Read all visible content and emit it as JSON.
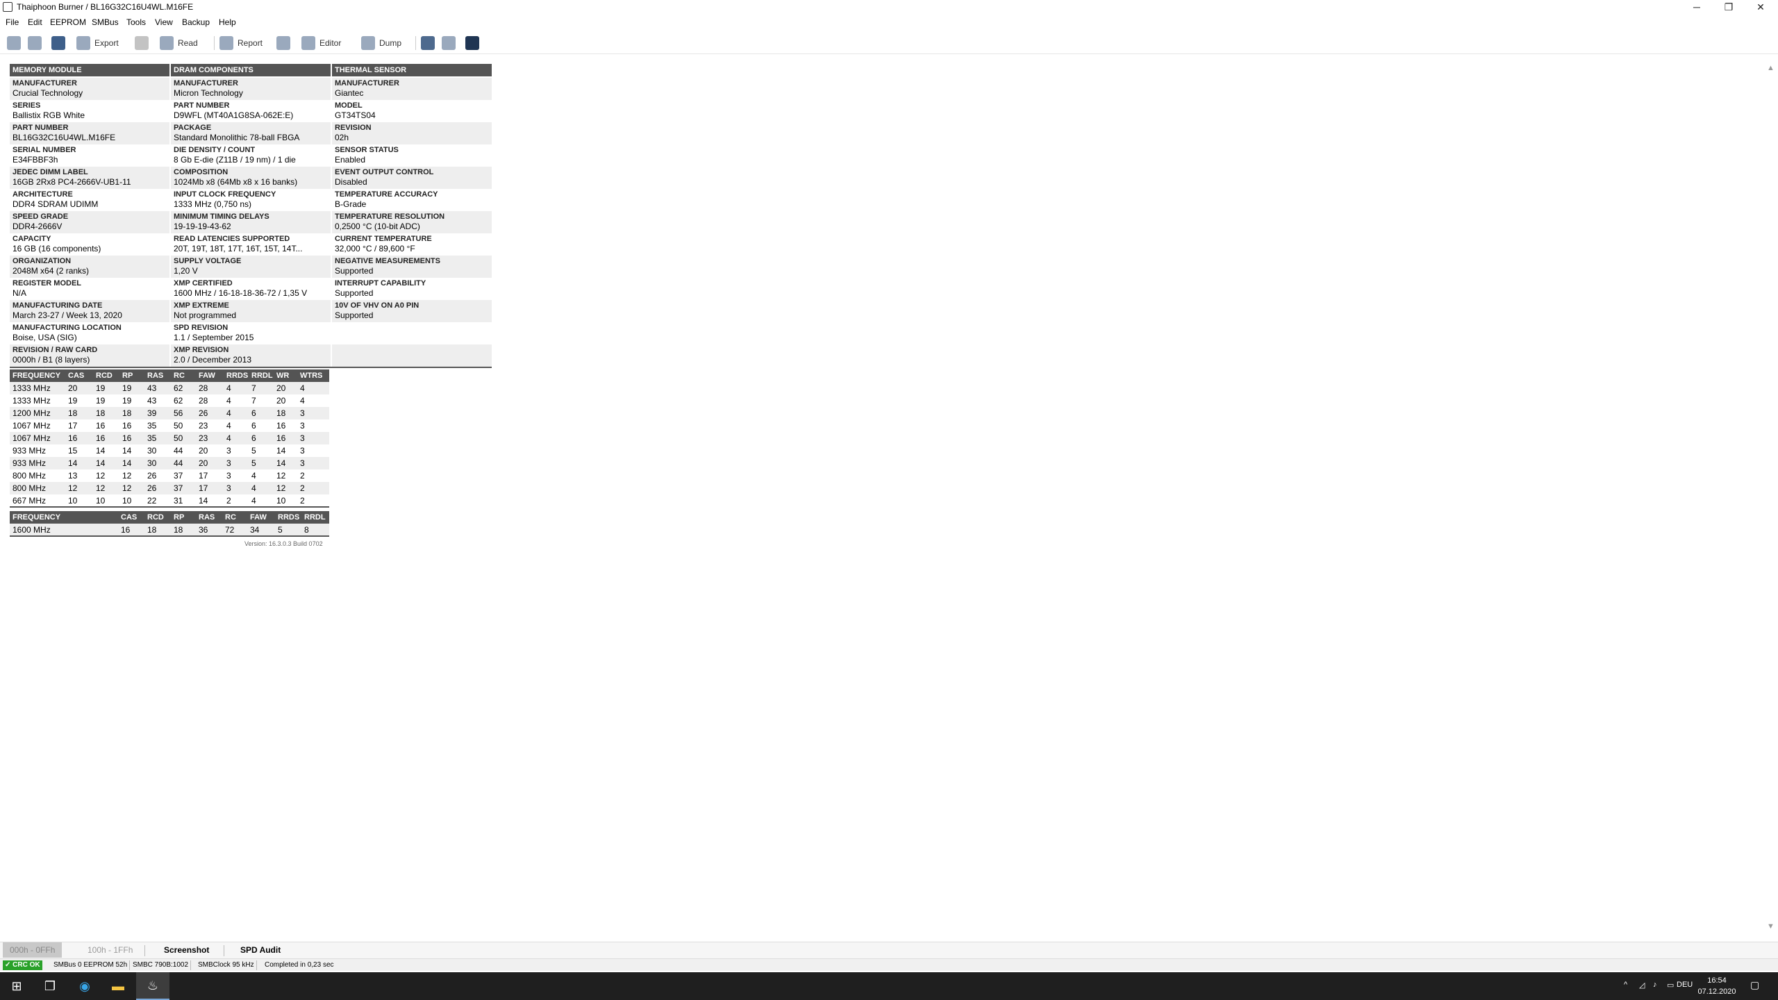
{
  "window": {
    "title": "Thaiphoon Burner / BL16G32C16U4WL.M16FE",
    "min_glyph": "─",
    "max_glyph": "❐",
    "close_glyph": "✕"
  },
  "menu": [
    "File",
    "Edit",
    "EEPROM",
    "SMBus",
    "Tools",
    "View",
    "Backup",
    "Help"
  ],
  "toolbar": {
    "export": "Export",
    "read": "Read",
    "report": "Report",
    "editor": "Editor",
    "dump": "Dump"
  },
  "memory_module": {
    "header": "MEMORY MODULE",
    "rows": [
      {
        "k": "MANUFACTURER",
        "v": "Crucial Technology"
      },
      {
        "k": "SERIES",
        "v": "Ballistix RGB White"
      },
      {
        "k": "PART NUMBER",
        "v": "BL16G32C16U4WL.M16FE"
      },
      {
        "k": "SERIAL NUMBER",
        "v": "E34FBBF3h"
      },
      {
        "k": "JEDEC DIMM LABEL",
        "v": "16GB 2Rx8 PC4-2666V-UB1-11"
      },
      {
        "k": "ARCHITECTURE",
        "v": "DDR4 SDRAM UDIMM"
      },
      {
        "k": "SPEED GRADE",
        "v": "DDR4-2666V"
      },
      {
        "k": "CAPACITY",
        "v": "16 GB (16 components)"
      },
      {
        "k": "ORGANIZATION",
        "v": "2048M x64 (2 ranks)"
      },
      {
        "k": "REGISTER MODEL",
        "v": "N/A"
      },
      {
        "k": "MANUFACTURING DATE",
        "v": "March 23-27 / Week 13, 2020"
      },
      {
        "k": "MANUFACTURING LOCATION",
        "v": "Boise, USA (SIG)"
      },
      {
        "k": "REVISION / RAW CARD",
        "v": "0000h / B1 (8 layers)"
      }
    ]
  },
  "dram_components": {
    "header": "DRAM COMPONENTS",
    "rows": [
      {
        "k": "MANUFACTURER",
        "v": "Micron Technology"
      },
      {
        "k": "PART NUMBER",
        "v": "D9WFL (MT40A1G8SA-062E:E)"
      },
      {
        "k": "PACKAGE",
        "v": "Standard Monolithic 78-ball FBGA"
      },
      {
        "k": "DIE DENSITY / COUNT",
        "v": "8 Gb E-die (Z11B / 19 nm) / 1 die"
      },
      {
        "k": "COMPOSITION",
        "v": "1024Mb x8 (64Mb x8 x 16 banks)"
      },
      {
        "k": "INPUT CLOCK FREQUENCY",
        "v": "1333 MHz (0,750 ns)"
      },
      {
        "k": "MINIMUM TIMING DELAYS",
        "v": "19-19-19-43-62"
      },
      {
        "k": "READ LATENCIES SUPPORTED",
        "v": "20T, 19T, 18T, 17T, 16T, 15T, 14T..."
      },
      {
        "k": "SUPPLY VOLTAGE",
        "v": "1,20 V"
      },
      {
        "k": "XMP CERTIFIED",
        "v": "1600 MHz / 16-18-18-36-72 / 1,35 V"
      },
      {
        "k": "XMP EXTREME",
        "v": "Not programmed"
      },
      {
        "k": "SPD REVISION",
        "v": "1.1 / September 2015"
      },
      {
        "k": "XMP REVISION",
        "v": "2.0 / December 2013"
      }
    ]
  },
  "thermal_sensor": {
    "header": "THERMAL SENSOR",
    "rows": [
      {
        "k": "MANUFACTURER",
        "v": "Giantec"
      },
      {
        "k": "MODEL",
        "v": "GT34TS04"
      },
      {
        "k": "REVISION",
        "v": "02h"
      },
      {
        "k": "SENSOR STATUS",
        "v": "Enabled"
      },
      {
        "k": "EVENT OUTPUT CONTROL",
        "v": "Disabled"
      },
      {
        "k": "TEMPERATURE ACCURACY",
        "v": "B-Grade"
      },
      {
        "k": "TEMPERATURE RESOLUTION",
        "v": "0,2500 °C (10-bit ADC)"
      },
      {
        "k": "CURRENT TEMPERATURE",
        "v": "32,000 °C / 89,600 °F"
      },
      {
        "k": "NEGATIVE MEASUREMENTS",
        "v": "Supported"
      },
      {
        "k": "INTERRUPT CAPABILITY",
        "v": "Supported"
      },
      {
        "k": "10V OF VHV ON A0 PIN",
        "v": "Supported"
      },
      {
        "k": "",
        "v": ""
      },
      {
        "k": "",
        "v": ""
      }
    ]
  },
  "jedec_timings": {
    "headers": [
      "FREQUENCY",
      "CAS",
      "RCD",
      "RP",
      "RAS",
      "RC",
      "FAW",
      "RRDS",
      "RRDL",
      "WR",
      "WTRS"
    ],
    "rows": [
      [
        "1333 MHz",
        "20",
        "19",
        "19",
        "43",
        "62",
        "28",
        "4",
        "7",
        "20",
        "4"
      ],
      [
        "1333 MHz",
        "19",
        "19",
        "19",
        "43",
        "62",
        "28",
        "4",
        "7",
        "20",
        "4"
      ],
      [
        "1200 MHz",
        "18",
        "18",
        "18",
        "39",
        "56",
        "26",
        "4",
        "6",
        "18",
        "3"
      ],
      [
        "1067 MHz",
        "17",
        "16",
        "16",
        "35",
        "50",
        "23",
        "4",
        "6",
        "16",
        "3"
      ],
      [
        "1067 MHz",
        "16",
        "16",
        "16",
        "35",
        "50",
        "23",
        "4",
        "6",
        "16",
        "3"
      ],
      [
        "933 MHz",
        "15",
        "14",
        "14",
        "30",
        "44",
        "20",
        "3",
        "5",
        "14",
        "3"
      ],
      [
        "933 MHz",
        "14",
        "14",
        "14",
        "30",
        "44",
        "20",
        "3",
        "5",
        "14",
        "3"
      ],
      [
        "800 MHz",
        "13",
        "12",
        "12",
        "26",
        "37",
        "17",
        "3",
        "4",
        "12",
        "2"
      ],
      [
        "800 MHz",
        "12",
        "12",
        "12",
        "26",
        "37",
        "17",
        "3",
        "4",
        "12",
        "2"
      ],
      [
        "667 MHz",
        "10",
        "10",
        "10",
        "22",
        "31",
        "14",
        "2",
        "4",
        "10",
        "2"
      ]
    ]
  },
  "xmp_timings": {
    "headers": [
      "FREQUENCY",
      "CAS",
      "RCD",
      "RP",
      "RAS",
      "RC",
      "FAW",
      "RRDS",
      "RRDL"
    ],
    "rows": [
      [
        "1600 MHz",
        "16",
        "18",
        "18",
        "36",
        "72",
        "34",
        "5",
        "8"
      ]
    ]
  },
  "version": "Version: 16.3.0.3 Build 0702",
  "tabs": {
    "t1": "000h - 0FFh",
    "t2": "100h - 1FFh",
    "t3": "Screenshot",
    "t4": "SPD Audit"
  },
  "status": {
    "crc": "✓ CRC OK",
    "smbus": "SMBus 0 EEPROM 52h",
    "smbc": "SMBC 790B:1002",
    "clock": "SMBClock 95 kHz",
    "completed": "Completed in 0,23 sec"
  },
  "taskbar": {
    "lang": "DEU",
    "time": "16:54",
    "date": "07.12.2020"
  }
}
